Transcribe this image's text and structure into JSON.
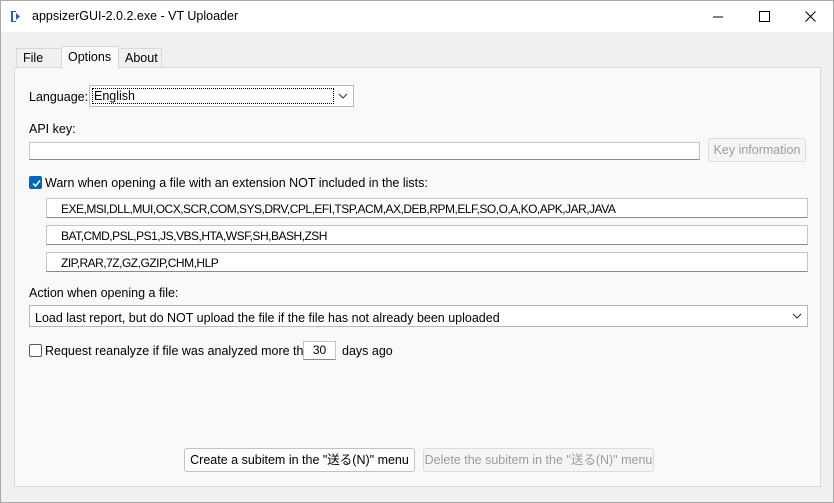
{
  "window": {
    "title": "appsizerGUI-2.0.2.exe - VT Uploader"
  },
  "tabs": [
    {
      "label": "File"
    },
    {
      "label": "Options"
    },
    {
      "label": "About"
    }
  ],
  "options": {
    "language_label": "Language:",
    "language_value": "English",
    "api_key_label": "API key:",
    "api_key_value": "",
    "key_info_button": "Key information",
    "warn_checkbox_label": "Warn when opening a file with an extension NOT included in the lists:",
    "warn_checked": true,
    "extension_lists": [
      "EXE,MSI,DLL,MUI,OCX,SCR,COM,SYS,DRV,CPL,EFI,TSP,ACM,AX,DEB,RPM,ELF,SO,O,A,KO,APK,JAR,JAVA",
      "BAT,CMD,PSL,PS1,JS,VBS,HTA,WSF,SH,BASH,ZSH",
      "ZIP,RAR,7Z,GZ,GZIP,CHM,HLP"
    ],
    "action_label": "Action when opening a file:",
    "action_value": "Load last report, but do NOT upload the file if the file has not already been uploaded",
    "reanalyze_label": "Request reanalyze if file was analyzed more than",
    "reanalyze_checked": false,
    "reanalyze_days": "30",
    "days_ago_label": "days ago",
    "create_button": "Create a subitem in the \"送る(N)\" menu",
    "delete_button": "Delete the subitem in the \"送る(N)\" menu"
  },
  "colors": {
    "accent": "#0067c0",
    "panel_bg": "#f9f9f9",
    "window_bg": "#f0f0f0"
  }
}
